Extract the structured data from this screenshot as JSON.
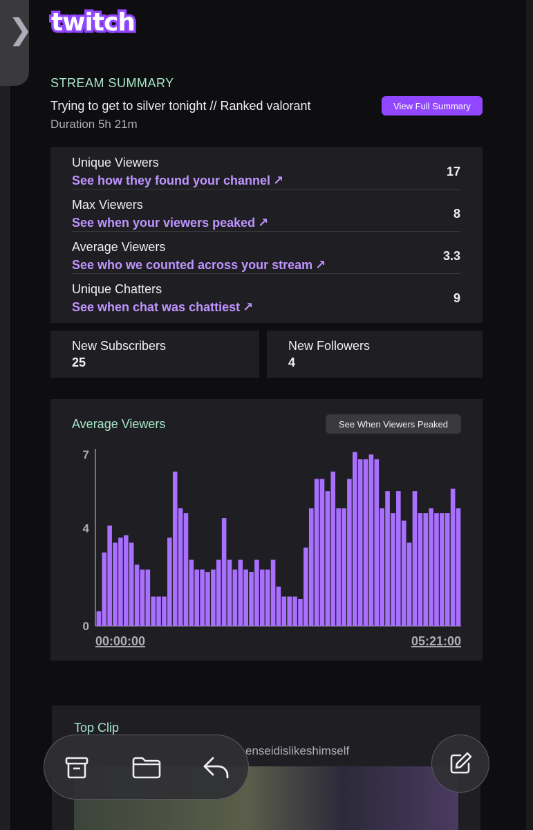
{
  "app": {
    "name": "twitch",
    "logo_text": "twitch"
  },
  "summary": {
    "section_label": "STREAM SUMMARY",
    "title": "Trying to get to silver tonight // Ranked valorant",
    "duration": "Duration 5h 21m",
    "view_full_label": "View Full Summary"
  },
  "stats": [
    {
      "label": "Unique Viewers",
      "link": "See how they found your channel",
      "value": "17"
    },
    {
      "label": "Max Viewers",
      "link": "See when your viewers peaked",
      "value": "8"
    },
    {
      "label": "Average Viewers",
      "link": "See who we counted across your stream",
      "value": "3.3"
    },
    {
      "label": "Unique Chatters",
      "link": "See when chat was chattiest",
      "value": "9"
    }
  ],
  "boxes": {
    "subscribers": {
      "label": "New Subscribers",
      "value": "25"
    },
    "followers": {
      "label": "New Followers",
      "value": "4"
    }
  },
  "chart_section": {
    "title": "Average Viewers",
    "button_label": "See When Viewers Peaked"
  },
  "chart_data": {
    "type": "bar",
    "title": "Average Viewers",
    "xlabel": "",
    "ylabel": "",
    "ylim": [
      0,
      7
    ],
    "y_ticks": [
      "0",
      "4",
      "7"
    ],
    "x_tick_labels": [
      "00:00:00",
      "05:21:00"
    ],
    "grid": false,
    "color": "#a970ff",
    "values": [
      0.6,
      3.0,
      4.1,
      3.4,
      3.6,
      3.7,
      3.4,
      2.5,
      2.3,
      2.3,
      1.2,
      1.2,
      1.2,
      3.6,
      6.3,
      4.8,
      4.6,
      2.7,
      2.3,
      2.3,
      2.2,
      2.3,
      2.7,
      4.4,
      2.7,
      2.3,
      2.7,
      2.3,
      2.2,
      2.7,
      2.3,
      2.3,
      2.7,
      1.6,
      1.2,
      1.2,
      1.2,
      1.1,
      3.2,
      4.8,
      6.0,
      6.0,
      5.5,
      6.3,
      4.8,
      4.8,
      6.0,
      7.1,
      6.8,
      6.8,
      7.0,
      6.8,
      4.8,
      5.5,
      4.6,
      5.5,
      4.3,
      3.4,
      5.5,
      4.6,
      4.6,
      4.8,
      4.6,
      4.6,
      4.6,
      5.6,
      4.8
    ]
  },
  "clip": {
    "title": "Top Clip",
    "author": "enseidislikeshimself"
  },
  "toolbar": {
    "archive_icon": "archive-icon",
    "folder_icon": "folder-icon",
    "reply_icon": "reply-icon",
    "compose_icon": "compose-icon"
  },
  "colors": {
    "accent": "#9147ff",
    "link": "#bf94ff",
    "heading": "#a8e6c9",
    "card": "#1f1f23",
    "bg": "#0e0e10"
  }
}
